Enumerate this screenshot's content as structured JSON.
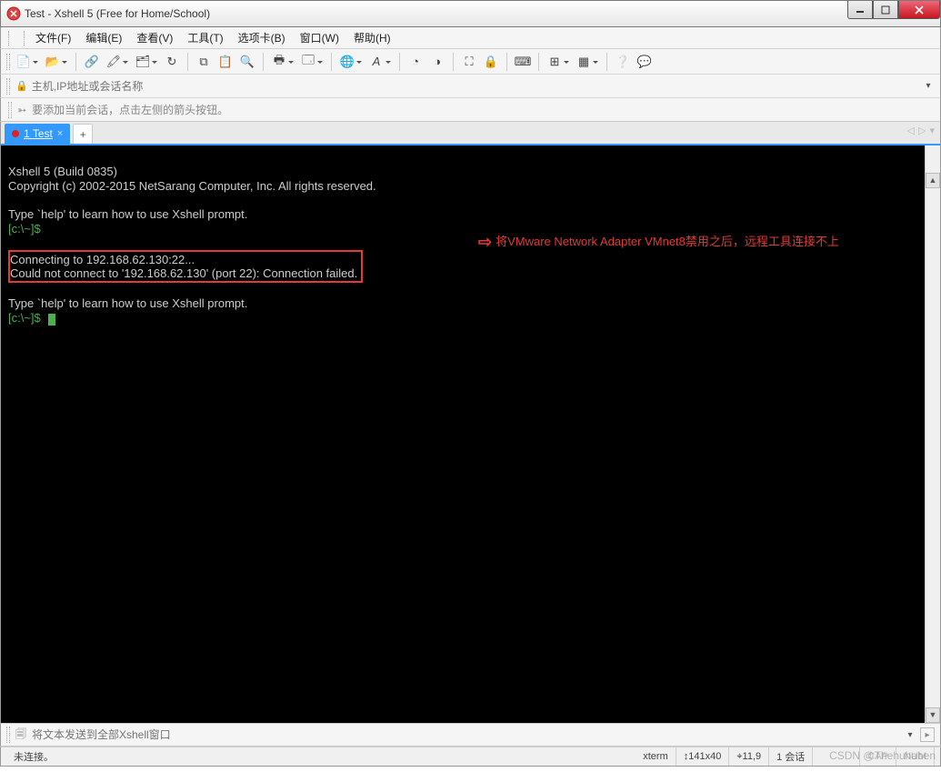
{
  "window": {
    "title": "Test - Xshell 5 (Free for Home/School)"
  },
  "menu": {
    "items": [
      "文件(F)",
      "编辑(E)",
      "查看(V)",
      "工具(T)",
      "选项卡(B)",
      "窗口(W)",
      "帮助(H)"
    ]
  },
  "toolbar_icons": [
    "new-doc",
    "open-folder",
    "link",
    "highlighter",
    "copy-props",
    "reconnect",
    "copy",
    "paste",
    "search",
    "print",
    "properties",
    "globe",
    "font",
    "color-scheme",
    "zoom-in",
    "fullscreen",
    "lock",
    "keyboard",
    "new-window",
    "tile",
    "help",
    "feedback"
  ],
  "addressbar": {
    "placeholder": "主机,IP地址或会话名称"
  },
  "hintbar": {
    "text": "要添加当前会话，点击左侧的箭头按钮。"
  },
  "tabs": {
    "active": {
      "index": "1",
      "name": "Test"
    }
  },
  "terminal": {
    "banner_line1": "Xshell 5 (Build 0835)",
    "banner_line2": "Copyright (c) 2002-2015 NetSarang Computer, Inc. All rights reserved.",
    "help_line": "Type `help' to learn how to use Xshell prompt.",
    "prompt": "[c:\\~]$",
    "connect_line1": "Connecting to 192.168.62.130:22...",
    "connect_line2": "Could not connect to '192.168.62.130' (port 22): Connection failed."
  },
  "annotation": {
    "text": "将VMware Network Adapter VMnet8禁用之后，远程工具连接不上"
  },
  "sendbar": {
    "placeholder": "将文本发送到全部Xshell窗口"
  },
  "status": {
    "state": "未连接。",
    "term": "xterm",
    "size": "141x40",
    "cursor": "11,9",
    "session": "1 会话",
    "caps": "CAP",
    "num": "NUM"
  },
  "watermark": "CSDN @Thehuhaben"
}
